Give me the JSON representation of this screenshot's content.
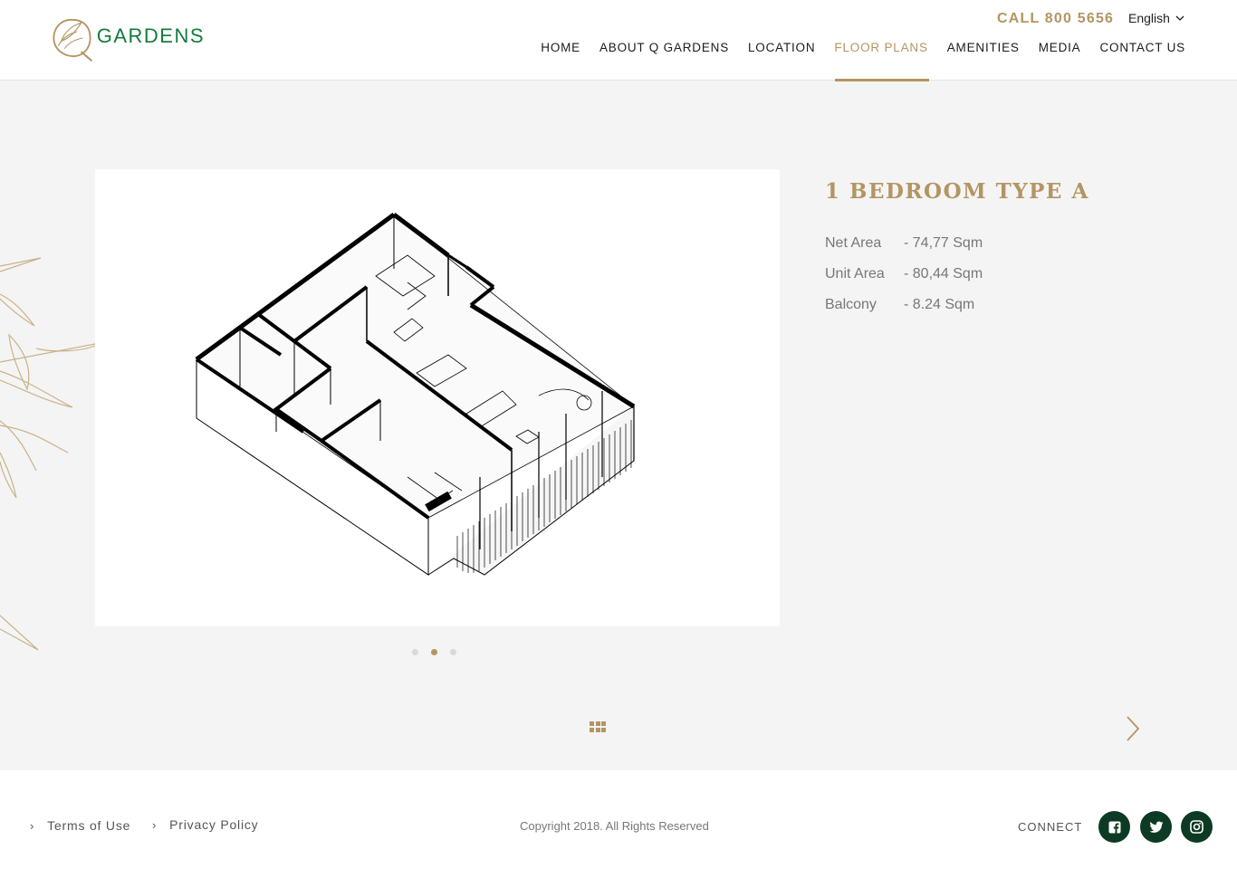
{
  "header": {
    "logo_text": "GARDENS",
    "call": "CALL  800 5656",
    "language": "English",
    "nav": [
      {
        "label": "HOME",
        "active": false
      },
      {
        "label": "ABOUT Q GARDENS",
        "active": false
      },
      {
        "label": "LOCATION",
        "active": false
      },
      {
        "label": "FLOOR PLANS",
        "active": true
      },
      {
        "label": "AMENITIES",
        "active": false
      },
      {
        "label": "MEDIA",
        "active": false
      },
      {
        "label": "CONTACT US",
        "active": false
      }
    ]
  },
  "unit": {
    "title": "1 BEDROOM TYPE A",
    "specs": [
      {
        "label": "Net Area",
        "value": "- 74,77 Sqm"
      },
      {
        "label": "Unit Area",
        "value": "- 80,44 Sqm"
      },
      {
        "label": "Balcony",
        "value": "- 8.24 Sqm"
      }
    ]
  },
  "carousel": {
    "slides": 3,
    "active_index": 1
  },
  "footer": {
    "terms": "Terms of Use",
    "privacy": "Privacy Policy",
    "copyright": "Copyright 2018. All Rights Reserved",
    "connect": "CONNECT",
    "social_icons": [
      "facebook-icon",
      "twitter-icon",
      "instagram-icon"
    ]
  },
  "colors": {
    "gold": "#b39562",
    "brand_green": "#137a3f",
    "social_bg": "#0d3a25"
  }
}
